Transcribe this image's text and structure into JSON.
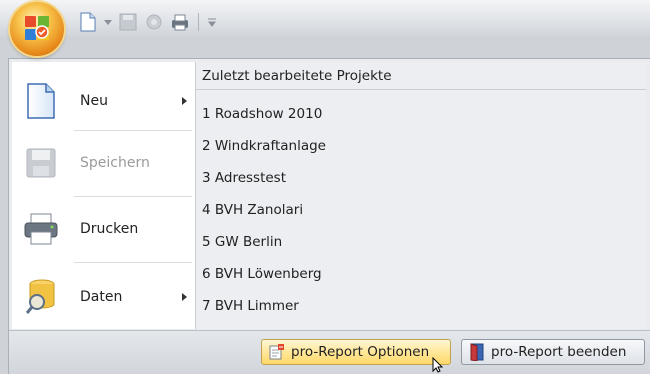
{
  "menu": {
    "commands": [
      {
        "label": "Neu",
        "icon": "new-document-icon",
        "has_submenu": true,
        "enabled": true
      },
      {
        "label": "Speichern",
        "icon": "save-disk-icon",
        "has_submenu": false,
        "enabled": false
      },
      {
        "label": "Drucken",
        "icon": "printer-icon",
        "has_submenu": false,
        "enabled": true
      },
      {
        "label": "Daten",
        "icon": "database-search-icon",
        "has_submenu": true,
        "enabled": true
      }
    ],
    "recent_title": "Zuletzt bearbeitete Projekte",
    "recent_items": [
      "1 Roadshow 2010",
      "2 Windkraftanlage",
      "3 Adresstest",
      "4 BVH Zanolari",
      "5 GW Berlin",
      "6 BVH Löwenberg",
      "7 BVH Limmer"
    ]
  },
  "buttons": {
    "options_label": "pro-Report Optionen",
    "exit_label": "pro-Report beenden"
  },
  "colors": {
    "accent_orange": "#e7891a",
    "hover_yellow": "#ffe79a",
    "menu_bg": "#e9ebee"
  }
}
